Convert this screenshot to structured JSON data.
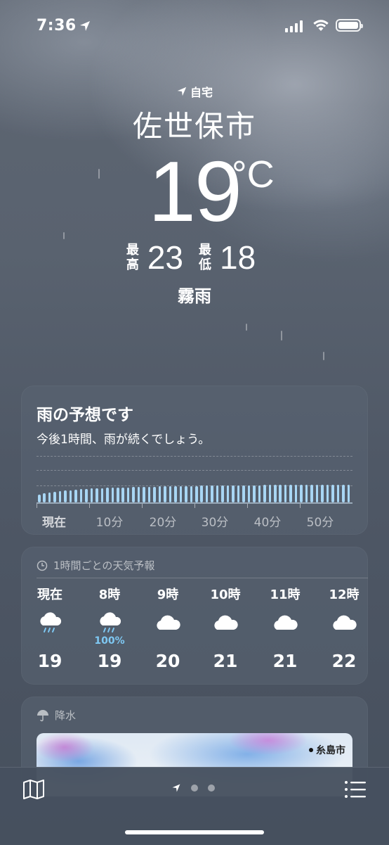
{
  "status_bar": {
    "time": "7:36"
  },
  "header": {
    "home_label": "自宅",
    "city": "佐世保市",
    "temperature": "19",
    "unit": "°C",
    "high_label": [
      "最",
      "高"
    ],
    "high_value": "23",
    "low_label": [
      "最",
      "低"
    ],
    "low_value": "18",
    "condition": "霧雨"
  },
  "rain_forecast": {
    "title": "雨の予想です",
    "description": "今後1時間、雨が続くでしょう。",
    "axis_labels": [
      "現在",
      "10分",
      "20分",
      "30分",
      "40分",
      "50分"
    ],
    "intensity": [
      0.3,
      0.35,
      0.38,
      0.4,
      0.42,
      0.44,
      0.46,
      0.48,
      0.5,
      0.51,
      0.52,
      0.53,
      0.54,
      0.55,
      0.56,
      0.56,
      0.57,
      0.57,
      0.58,
      0.58,
      0.58,
      0.59,
      0.59,
      0.6,
      0.6,
      0.6,
      0.61,
      0.61,
      0.62,
      0.62,
      0.62,
      0.63,
      0.63,
      0.63,
      0.64,
      0.64,
      0.64,
      0.64,
      0.65,
      0.65,
      0.65,
      0.65,
      0.65,
      0.66,
      0.66,
      0.66,
      0.66,
      0.66,
      0.66,
      0.66,
      0.66,
      0.66,
      0.66,
      0.66,
      0.66,
      0.66,
      0.66,
      0.66,
      0.66,
      0.66
    ],
    "bar_color": "#a8d6f4"
  },
  "hourly": {
    "heading": "1時間ごとの天気予報",
    "hours": [
      {
        "label": "現在",
        "icon": "rain-cloud-icon",
        "pop": "",
        "temp": "19"
      },
      {
        "label": "8時",
        "icon": "rain-cloud-icon",
        "pop": "100%",
        "temp": "19"
      },
      {
        "label": "9時",
        "icon": "cloud-icon",
        "pop": "",
        "temp": "20"
      },
      {
        "label": "10時",
        "icon": "cloud-icon",
        "pop": "",
        "temp": "21"
      },
      {
        "label": "11時",
        "icon": "cloud-icon",
        "pop": "",
        "temp": "21"
      },
      {
        "label": "12時",
        "icon": "cloud-icon",
        "pop": "",
        "temp": "22"
      }
    ]
  },
  "precipitation": {
    "heading": "降水",
    "map_label": "糸島市"
  },
  "toolbar": {
    "map_icon": "map-icon",
    "list_icon": "list-icon"
  }
}
